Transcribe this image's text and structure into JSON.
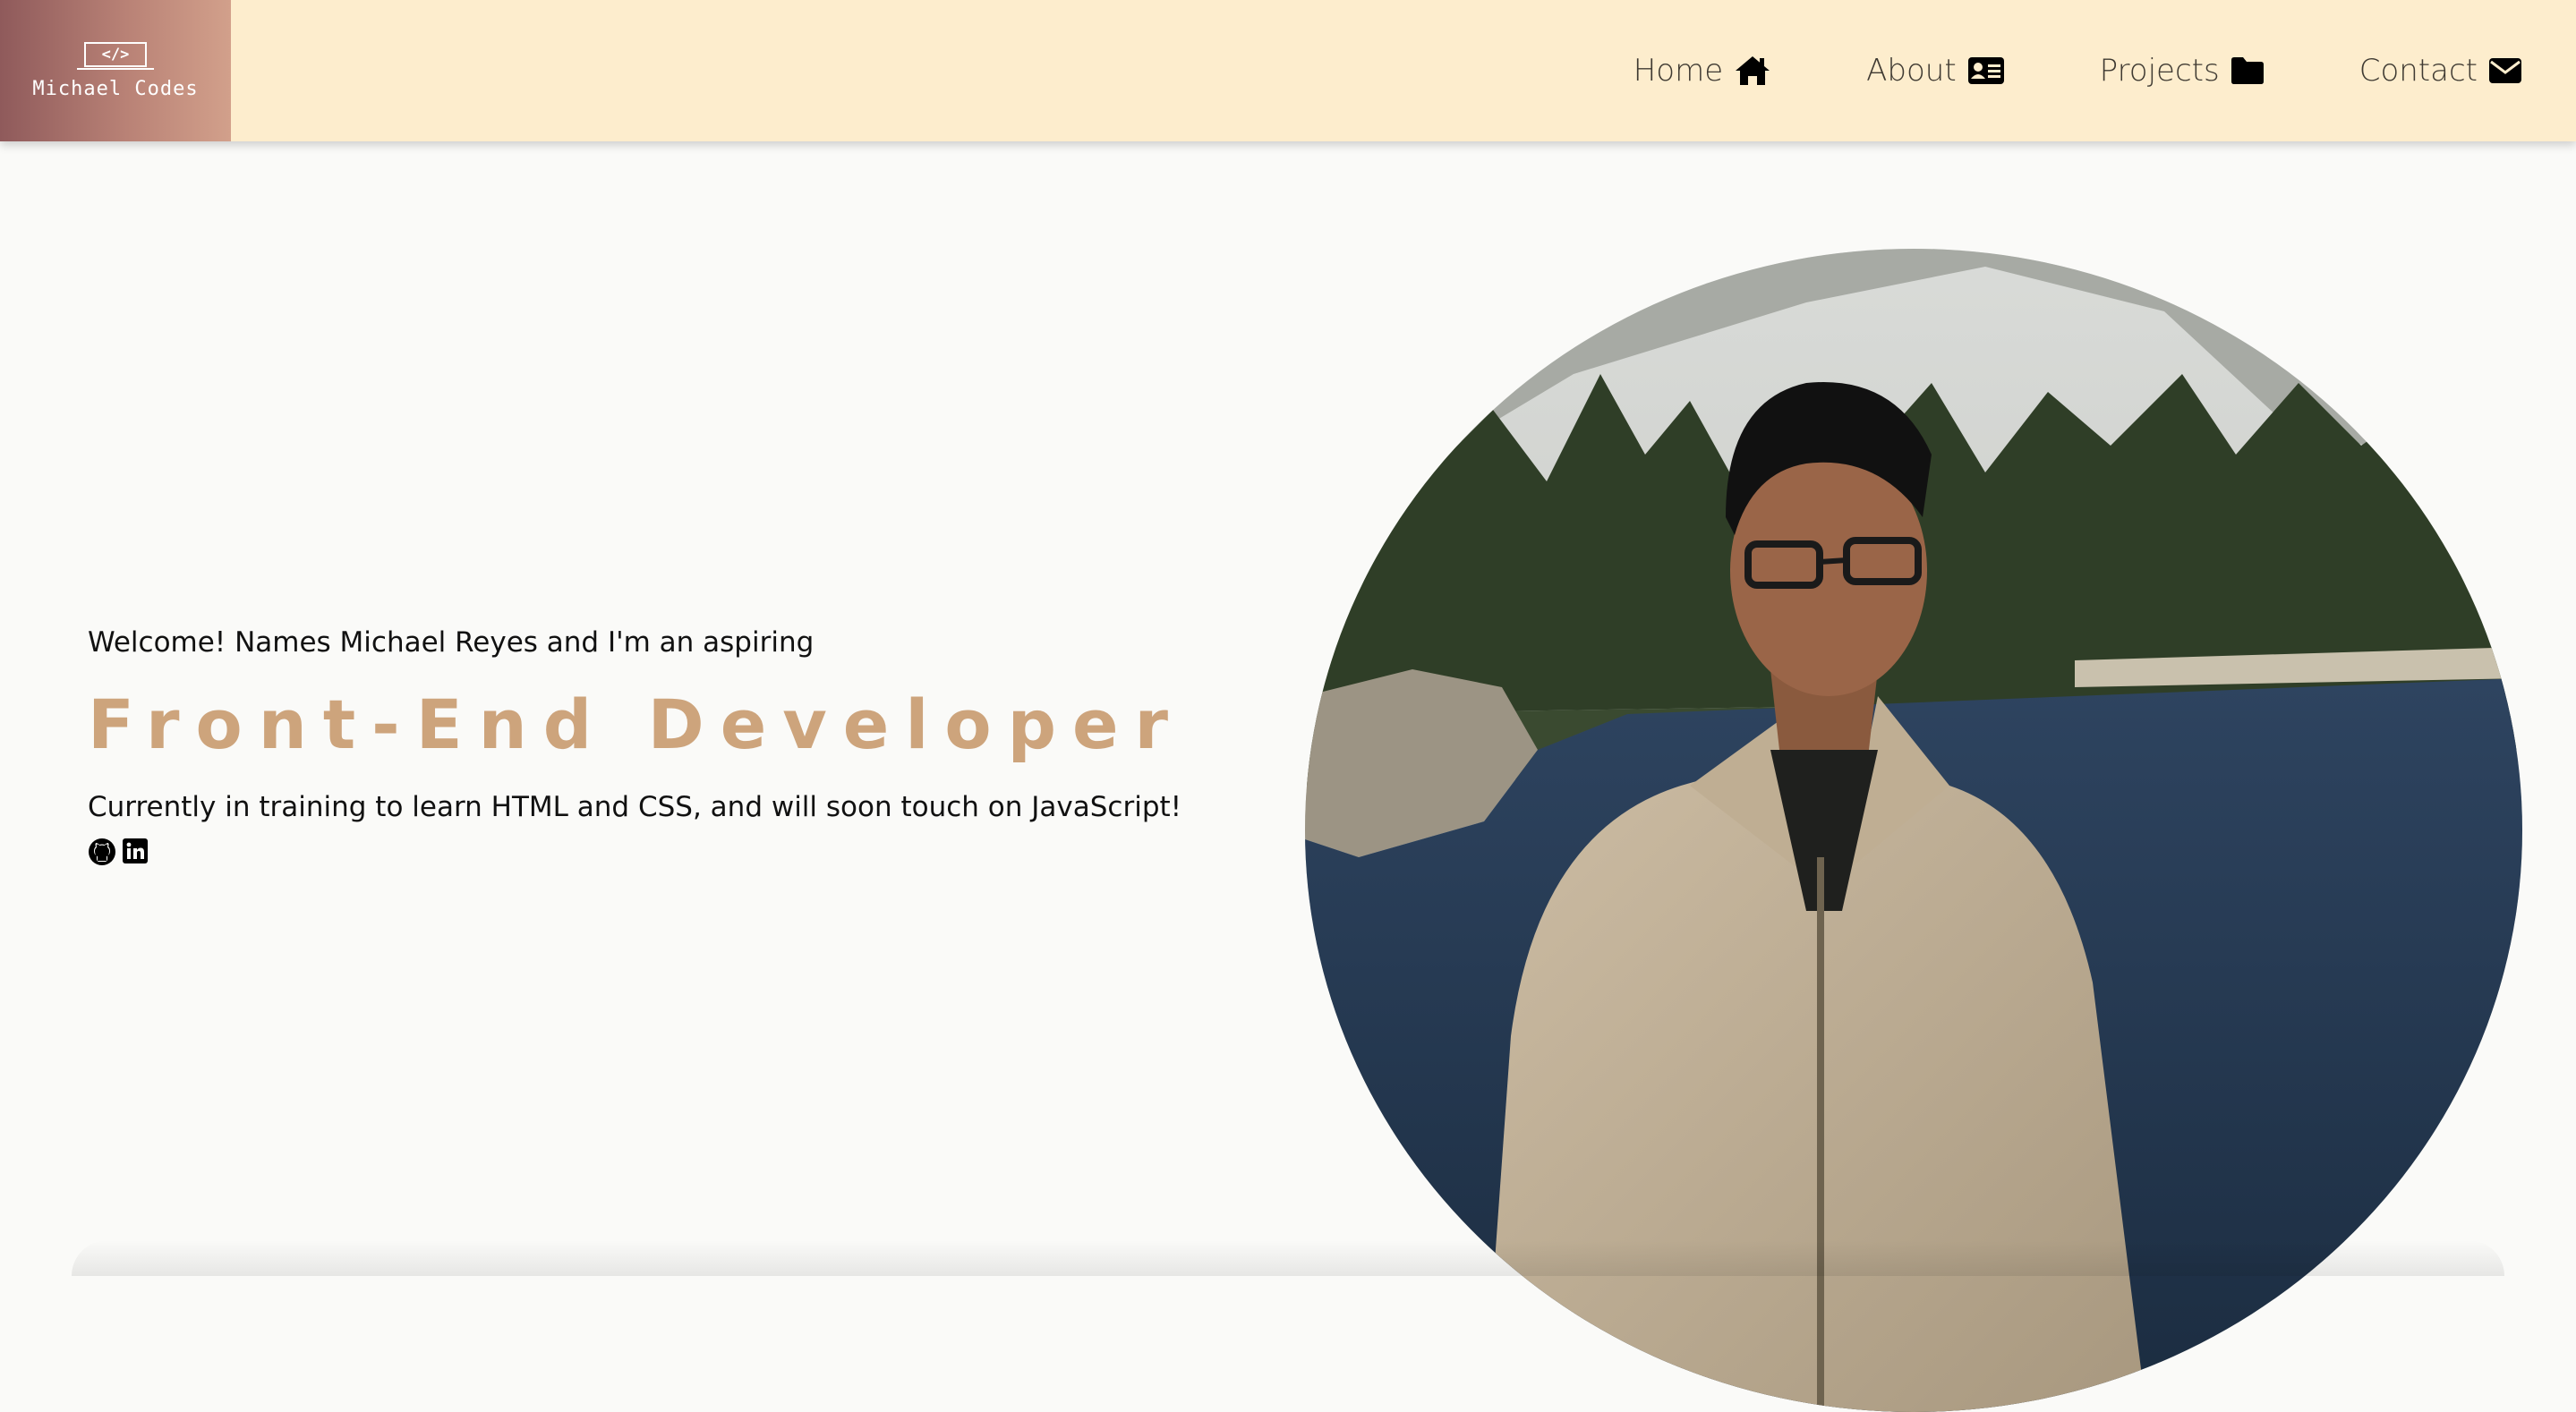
{
  "header": {
    "logo_mark": "</>",
    "logo_text": "Michael Codes",
    "nav": [
      {
        "label": "Home",
        "icon": "home-icon"
      },
      {
        "label": "About",
        "icon": "id-card-icon"
      },
      {
        "label": "Projects",
        "icon": "folder-icon"
      },
      {
        "label": "Contact",
        "icon": "envelope-icon"
      }
    ]
  },
  "hero": {
    "welcome": "Welcome! Names Michael Reyes and I'm an aspiring",
    "role": "Front-End Developer",
    "description": "Currently in training to learn HTML and CSS, and will soon touch on JavaScript!",
    "socials": [
      {
        "icon": "github-icon"
      },
      {
        "icon": "linkedin-icon"
      }
    ],
    "photo_alt": "Portrait photo of Michael Reyes by a lake"
  },
  "colors": {
    "header_bg": "#fdedcd",
    "accent": "#cda47c",
    "page_bg": "#fafaf8",
    "logo_gradient_start": "#8f5a5b",
    "logo_gradient_end": "#d2a08b"
  }
}
